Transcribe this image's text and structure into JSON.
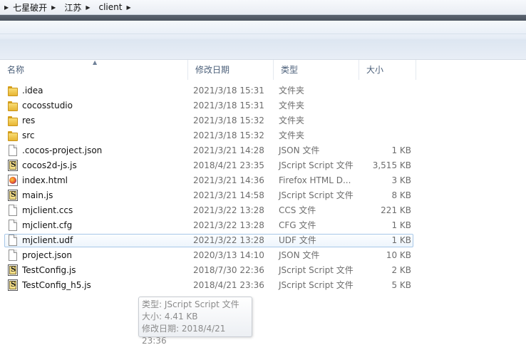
{
  "breadcrumb": [
    "七星破开",
    "江苏",
    "client"
  ],
  "columns": {
    "name": "名称",
    "date": "修改日期",
    "type": "类型",
    "size": "大小"
  },
  "files": [
    {
      "icon": "folder-icon",
      "name": ".idea",
      "date": "2021/3/18 15:31",
      "type": "文件夹",
      "size": ""
    },
    {
      "icon": "folder-icon",
      "name": "cocosstudio",
      "date": "2021/3/18 15:31",
      "type": "文件夹",
      "size": ""
    },
    {
      "icon": "folder-icon",
      "name": "res",
      "date": "2021/3/18 15:32",
      "type": "文件夹",
      "size": ""
    },
    {
      "icon": "folder-icon",
      "name": "src",
      "date": "2021/3/18 15:32",
      "type": "文件夹",
      "size": ""
    },
    {
      "icon": "file-icon",
      "name": ".cocos-project.json",
      "date": "2021/3/21 14:28",
      "type": "JSON 文件",
      "size": "1 KB"
    },
    {
      "icon": "js-icon",
      "name": "cocos2d-js.js",
      "date": "2018/4/21 23:35",
      "type": "JScript Script 文件",
      "size": "3,515 KB"
    },
    {
      "icon": "html-icon",
      "name": "index.html",
      "date": "2021/3/21 14:36",
      "type": "Firefox HTML D...",
      "size": "3 KB"
    },
    {
      "icon": "js-icon",
      "name": "main.js",
      "date": "2021/3/21 14:58",
      "type": "JScript Script 文件",
      "size": "8 KB"
    },
    {
      "icon": "file-icon",
      "name": "mjclient.ccs",
      "date": "2021/3/22 13:28",
      "type": "CCS 文件",
      "size": "221 KB"
    },
    {
      "icon": "file-icon",
      "name": "mjclient.cfg",
      "date": "2021/3/22 13:28",
      "type": "CFG 文件",
      "size": "1 KB"
    },
    {
      "icon": "file-icon",
      "name": "mjclient.udf",
      "date": "2021/3/22 13:28",
      "type": "UDF 文件",
      "size": "1 KB",
      "selected": true
    },
    {
      "icon": "file-icon",
      "name": "project.json",
      "date": "2020/3/13 14:10",
      "type": "JSON 文件",
      "size": "10 KB"
    },
    {
      "icon": "js-icon",
      "name": "TestConfig.js",
      "date": "2018/7/30 22:36",
      "type": "JScript Script 文件",
      "size": "2 KB"
    },
    {
      "icon": "js-icon",
      "name": "TestConfig_h5.js",
      "date": "2018/4/21 23:36",
      "type": "JScript Script 文件",
      "size": "5 KB"
    }
  ],
  "tooltip": {
    "type_line": "类型: JScript Script 文件",
    "size_line": "大小: 4.41 KB",
    "date_line": "修改日期: 2018/4/21 23:36"
  }
}
